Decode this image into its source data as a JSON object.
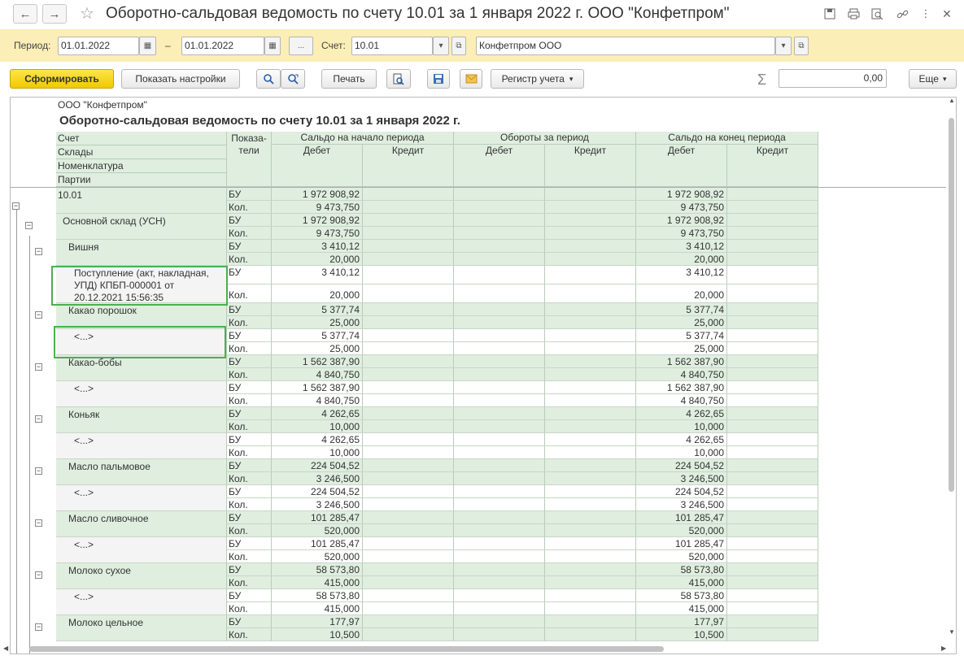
{
  "window": {
    "title": "Оборотно-сальдовая ведомость по счету 10.01 за 1 января 2022 г. ООО \"Конфетпром\""
  },
  "filter": {
    "period_label": "Период:",
    "date_from": "01.01.2022",
    "dash": "–",
    "date_to": "01.01.2022",
    "dots": "...",
    "account_label": "Счет:",
    "account": "10.01",
    "organization": "Конфетпром ООО"
  },
  "toolbar": {
    "generate": "Сформировать",
    "settings": "Показать настройки",
    "print": "Печать",
    "register": "Регистр учета",
    "sum_value": "0,00",
    "more": "Еще"
  },
  "report": {
    "org": "ООО \"Конфетпром\"",
    "title": "Оборотно-сальдовая ведомость по счету 10.01 за 1 января 2022 г.",
    "left_headers": [
      "Счет",
      "Склады",
      "Номенклатура",
      "Партии"
    ],
    "indicators_header_1": "Показа-",
    "indicators_header_2": "тели",
    "groups": [
      "Сальдо на начало периода",
      "Обороты за период",
      "Сальдо на конец периода"
    ],
    "debit": "Дебет",
    "credit": "Кредит",
    "rows": [
      {
        "name": "10.01",
        "level": 0,
        "bu": "1 972 908,92",
        "kol": "9 473,750"
      },
      {
        "name": "Основной склад (УСН)",
        "level": 1,
        "bu": "1 972 908,92",
        "kol": "9 473,750"
      },
      {
        "name": "Вишня",
        "level": 2,
        "bu": "3 410,12",
        "kol": "20,000"
      },
      {
        "name": "Поступление (акт, накладная, УПД) КПБП-000001 от 20.12.2021 15:56:35",
        "level": 3,
        "bu": "3 410,12",
        "kol": "20,000"
      },
      {
        "name": "Какао порошок",
        "level": 2,
        "bu": "5 377,74",
        "kol": "25,000"
      },
      {
        "name": "<...>",
        "level": 3,
        "bu": "5 377,74",
        "kol": "25,000"
      },
      {
        "name": "Какао-бобы",
        "level": 2,
        "bu": "1 562 387,90",
        "kol": "4 840,750"
      },
      {
        "name": "<...>",
        "level": 3,
        "bu": "1 562 387,90",
        "kol": "4 840,750"
      },
      {
        "name": "Коньяк",
        "level": 2,
        "bu": "4 262,65",
        "kol": "10,000"
      },
      {
        "name": "<...>",
        "level": 3,
        "bu": "4 262,65",
        "kol": "10,000"
      },
      {
        "name": "Масло пальмовое",
        "level": 2,
        "bu": "224 504,52",
        "kol": "3 246,500"
      },
      {
        "name": "<...>",
        "level": 3,
        "bu": "224 504,52",
        "kol": "3 246,500"
      },
      {
        "name": "Масло сливочное",
        "level": 2,
        "bu": "101 285,47",
        "kol": "520,000"
      },
      {
        "name": "<...>",
        "level": 3,
        "bu": "101 285,47",
        "kol": "520,000"
      },
      {
        "name": "Молоко сухое",
        "level": 2,
        "bu": "58 573,80",
        "kol": "415,000"
      },
      {
        "name": "<...>",
        "level": 3,
        "bu": "58 573,80",
        "kol": "415,000"
      },
      {
        "name": "Молоко цельное",
        "level": 2,
        "bu": "177,97",
        "kol": "10,500"
      }
    ],
    "bu_label": "БУ",
    "kol_label": "Кол."
  },
  "colors": {
    "filter_bg": "#fbeeb6",
    "header_green": "#dfeedf",
    "selection": "#4caf50",
    "generate_btn": "#f5d20c"
  }
}
